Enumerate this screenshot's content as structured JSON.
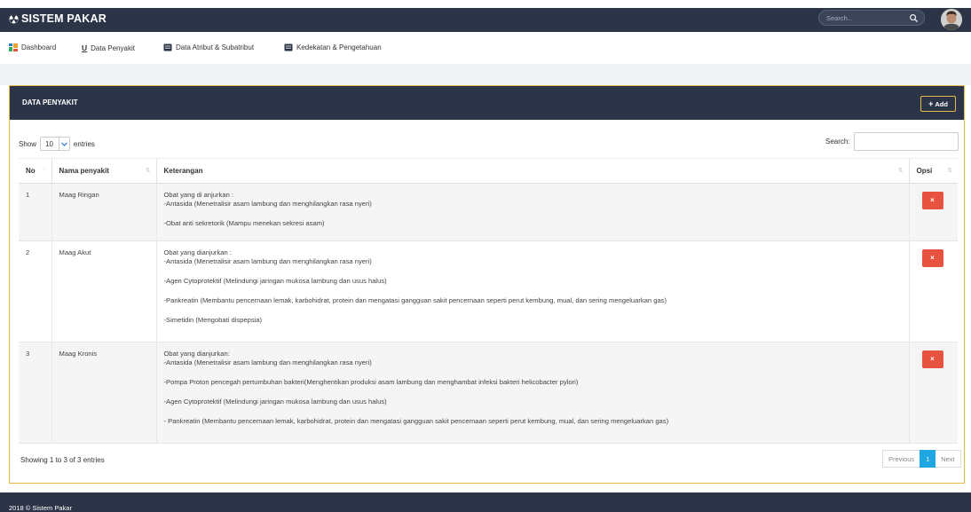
{
  "app": {
    "brand": "SISTEM PAKAR",
    "search_placeholder": "Search..."
  },
  "nav": {
    "items": [
      {
        "label": "Dashboard",
        "icon": "dashboard-icon"
      },
      {
        "label": "Data Penyakit",
        "icon": "u-underline-icon",
        "prefix": "U"
      },
      {
        "label": "Data Atribut & Subatribut",
        "icon": "database-icon"
      },
      {
        "label": "Kedekatan & Pengetahuan",
        "icon": "database-icon"
      }
    ]
  },
  "panel": {
    "title": "DATA PENYAKIT",
    "add_label": "Add",
    "show_label": "Show",
    "entries_label": "entries",
    "page_length": "10",
    "search_label": "Search:"
  },
  "table": {
    "headers": {
      "no": "No",
      "nama": "Nama penyakit",
      "keterangan": "Keterangan",
      "opsi": "Opsi"
    },
    "rows": [
      {
        "no": "1",
        "nama": "Maag Ringan",
        "ket_lines": [
          "Obat yang di anjurkan :",
          "-Antasida (Menetralisir asam lambung dan menghilangkan rasa nyeri)",
          "",
          "-Obat anti sekretorik (Mampu menekan sekresi asam)"
        ],
        "delete_label": "×"
      },
      {
        "no": "2",
        "nama": "Maag Akut",
        "ket_lines": [
          "Obat yang dianjurkan :",
          "-Antasida (Menetralisir asam lambung dan menghilangkan rasa nyeri)",
          "",
          "-Agen Cytoprotektif (Melindungi jaringan mukosa lambung dan usus halus)",
          "",
          "-Pankreatin (Membantu pencernaan lemak, karbohidrat, protein dan mengatasi gangguan sakit pencernaan seperti perut kembung, mual, dan sering mengeluarkan gas)",
          "",
          "-Simetidin (Mengobati dispepsia)"
        ],
        "delete_label": "×"
      },
      {
        "no": "3",
        "nama": "Maag Kronis",
        "ket_lines": [
          "Obat yang dianjurkan:",
          "-Antasida (Menetralisir asam lambung dan menghilangkan rasa nyeri)",
          "",
          "-Pompa Proton pencegah pertumbuhan bakteri(Menghentikan produksi asam lambung dan menghambat infeksi bakteri helicobacter pylori)",
          "",
          "-Agen Cytoprotektif (Melindungi jaringan mukosa lambung dan usus halus)",
          "",
          "- Pankreatin (Membantu pencernaan lemak, karbohidrat, protein dan mengatasi gangguan sakit pencernaan seperti perut kembung, mual, dan sering mengeluarkan gas)"
        ],
        "delete_label": "×"
      }
    ]
  },
  "pagination": {
    "info": "Showing 1 to 3 of 3 entries",
    "previous": "Previous",
    "current": "1",
    "next": "Next"
  },
  "footer": {
    "text": "2018 © Sistem Pakar"
  },
  "colors": {
    "navy": "#2c3447",
    "accent_border": "#e8b84a",
    "delete_red": "#e8533f",
    "page_active": "#1ea7e3"
  }
}
